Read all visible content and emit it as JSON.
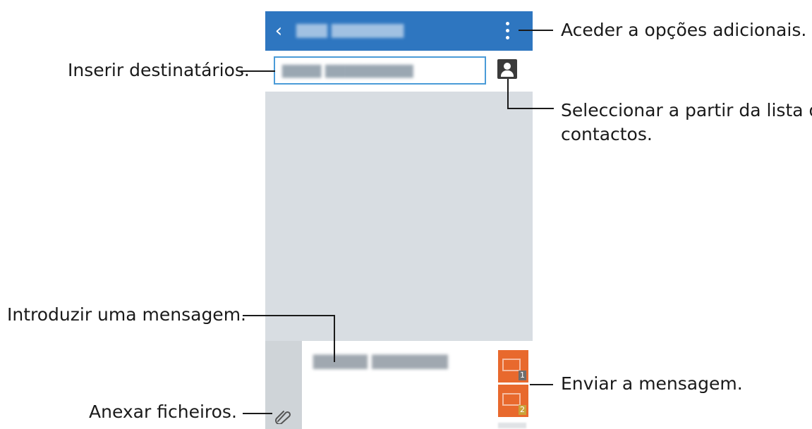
{
  "callouts": {
    "more_options": "Aceder a opções adicionais.",
    "enter_recipients": "Inserir destinatários.",
    "contacts_line1": "Seleccionar a partir da lista de",
    "contacts_line2": "contactos.",
    "enter_message": "Introduzir uma mensagem.",
    "send_message": "Enviar a mensagem.",
    "attach_files": "Anexar ficheiros."
  },
  "phone": {
    "appbar": {
      "back_icon": "chevron-left-icon",
      "more_icon": "vertical-ellipsis-icon",
      "color": "#2e76c0"
    },
    "recipient_field": {
      "contact_icon": "contact-card-icon"
    },
    "compose": {
      "attach_icon": "paperclip-icon",
      "send_buttons": [
        {
          "sim_label": "1",
          "color": "#e8692d"
        },
        {
          "sim_label": "2",
          "color": "#e8692d"
        }
      ]
    }
  }
}
